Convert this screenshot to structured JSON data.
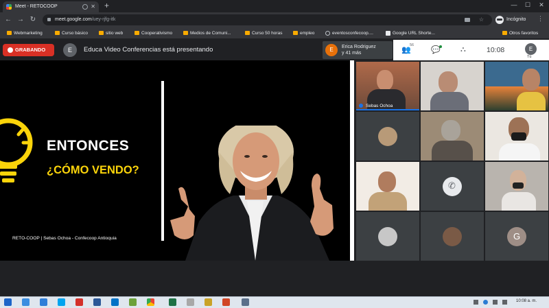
{
  "browser": {
    "tab_title": "Meet - RETOCOOP",
    "url_host": "meet.google.com",
    "url_path": "/uey-rjfg-itk",
    "incognito_label": "Incógnito",
    "bookmarks": [
      {
        "label": "Webmarketing",
        "icon": "folder-icon"
      },
      {
        "label": "Curso básico",
        "icon": "folder-icon"
      },
      {
        "label": "sitio web",
        "icon": "folder-icon"
      },
      {
        "label": "Cooperativismo",
        "icon": "folder-icon"
      },
      {
        "label": "Medios de Comuni...",
        "icon": "folder-icon"
      },
      {
        "label": "Curso 50 horas",
        "icon": "folder-icon"
      },
      {
        "label": "empleo",
        "icon": "folder-icon"
      },
      {
        "label": "eventosconfecoop....",
        "icon": "globe-icon"
      },
      {
        "label": "Google URL Shorte...",
        "icon": "google-icon"
      },
      {
        "label": "Otros favoritos",
        "icon": "folder-icon"
      }
    ]
  },
  "meet": {
    "recording_label": "GRABANDO",
    "presenter_initial": "E",
    "presenting_text": "Educa Video Conferencias está presentando",
    "participant_chip": {
      "initial": "E",
      "line1": "Erica Rodriguez",
      "line2": "y 41 más"
    },
    "participant_count": "56",
    "time": "10:08",
    "self_initial": "E",
    "self_label": "Tú"
  },
  "slide": {
    "heading": "ENTONCES",
    "subheading": "¿CÓMO VENDO?",
    "credit": "RETO-COOP | Sebas Ochoa - Confecoop Antioquia"
  },
  "participants": {
    "speaker_name": "Sebas Ochoa",
    "g_initial": "G"
  },
  "taskbar": {
    "time": "10:08 a. m."
  },
  "colors": {
    "record_red": "#d93025",
    "slide_yellow": "#fbd40a",
    "meet_blue": "#1a73e8"
  }
}
